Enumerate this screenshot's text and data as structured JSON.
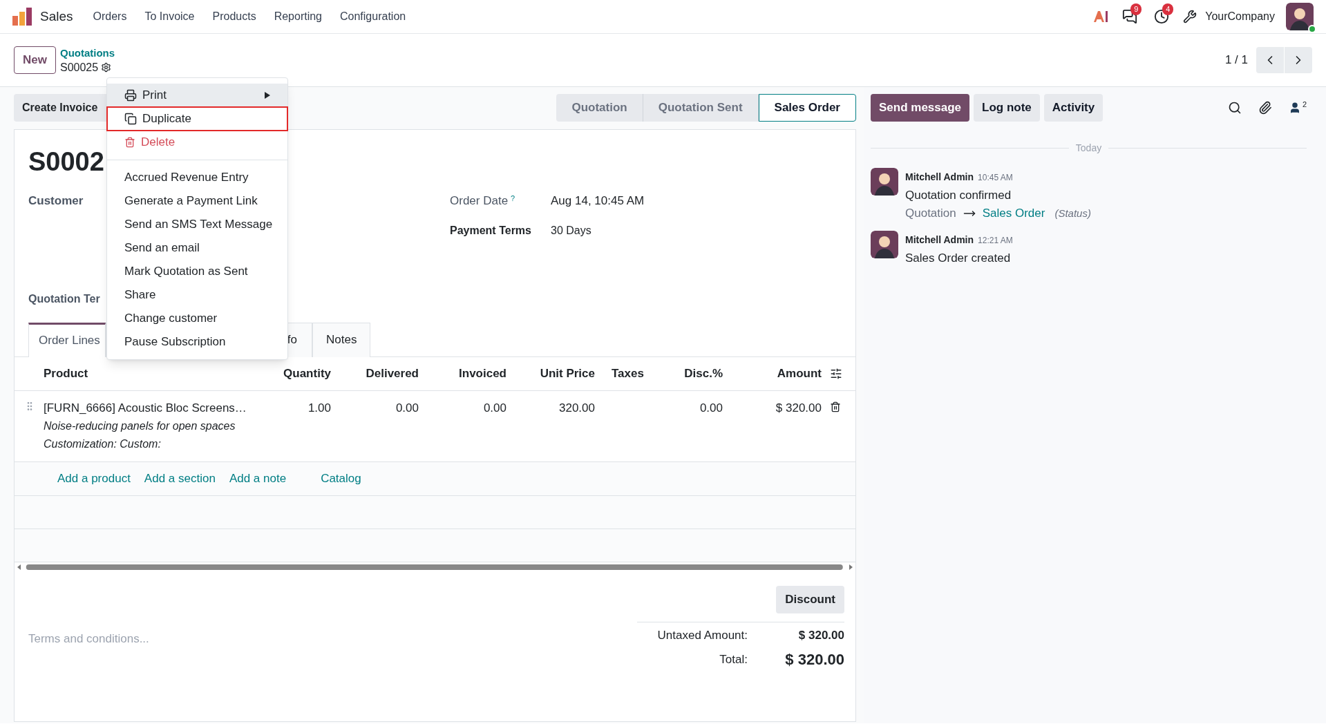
{
  "navbar": {
    "app": "Sales",
    "menus": [
      "Orders",
      "To Invoice",
      "Products",
      "Reporting",
      "Configuration"
    ],
    "badges": [
      {
        "kind": "chat",
        "count": "9"
      },
      {
        "kind": "activity",
        "count": "4"
      }
    ],
    "company": "YourCompany"
  },
  "control_panel": {
    "new_button": "New",
    "breadcrumb": "Quotations",
    "record": "S00025",
    "pager": "1 / 1"
  },
  "create_invoice": "Create Invoice",
  "statusbar": [
    {
      "label": "Quotation",
      "selected": false
    },
    {
      "label": "Quotation Sent",
      "selected": false
    },
    {
      "label": "Sales Order",
      "selected": true
    }
  ],
  "action_menu": {
    "sections": [
      {
        "items": [
          {
            "kind": "submenu",
            "label": "Print",
            "active": true,
            "highlighted": false
          },
          {
            "kind": "duplicate",
            "label": "Duplicate",
            "active": false,
            "highlighted": true
          },
          {
            "kind": "delete",
            "label": "Delete",
            "active": false,
            "highlighted": false
          }
        ]
      },
      {
        "items": [
          {
            "kind": "plain",
            "label": "Accrued Revenue Entry",
            "active": false,
            "highlighted": false
          },
          {
            "kind": "plain",
            "label": "Generate a Payment Link",
            "active": false,
            "highlighted": false
          },
          {
            "kind": "plain",
            "label": "Send an SMS Text Message",
            "active": false,
            "highlighted": false
          },
          {
            "kind": "plain",
            "label": "Send an email",
            "active": false,
            "highlighted": false
          },
          {
            "kind": "plain",
            "label": "Mark Quotation as Sent",
            "active": false,
            "highlighted": false
          },
          {
            "kind": "plain",
            "label": "Share",
            "active": false,
            "highlighted": false
          },
          {
            "kind": "plain",
            "label": "Change customer",
            "active": false,
            "highlighted": false
          },
          {
            "kind": "plain",
            "label": "Pause Subscription",
            "active": false,
            "highlighted": false
          }
        ]
      }
    ]
  },
  "form": {
    "title": "S0002",
    "customer_label": "Customer",
    "order_date_label": "Order Date",
    "order_date_help": "?",
    "order_date": "Aug 14, 10:45 AM",
    "payment_terms_label": "Payment Terms",
    "payment_terms": "30 Days",
    "template_label": "Quotation Ter"
  },
  "tabs": [
    {
      "label": "Order Lines",
      "selected": true
    },
    {
      "label": "fo",
      "selected": false
    },
    {
      "label": "Notes",
      "selected": false
    }
  ],
  "table": {
    "columns": [
      "Product",
      "Quantity",
      "Delivered",
      "Invoiced",
      "Unit Price",
      "Taxes",
      "Disc.%",
      "Amount"
    ],
    "rows": [
      {
        "product": "[FURN_6666] Acoustic Bloc Screens…",
        "description": [
          "Noise-reducing panels for open spaces",
          "Customization: Custom:"
        ],
        "quantity": "1.00",
        "delivered": "0.00",
        "invoiced": "0.00",
        "unit_price": "320.00",
        "discount": "0.00",
        "amount": "$ 320.00"
      }
    ],
    "add_links": [
      "Add a product",
      "Add a section",
      "Add a note",
      "Catalog"
    ]
  },
  "discount_button": "Discount",
  "terms": {
    "placeholder": "Terms and conditions..."
  },
  "totals": [
    {
      "kind": "subtotal",
      "label": "Untaxed Amount:",
      "value": "$ 320.00"
    },
    {
      "kind": "total",
      "label": "Total:",
      "value": "$ 320.00"
    }
  ],
  "chatter": {
    "buttons": [
      {
        "label": "Send message",
        "primary": true
      },
      {
        "label": "Log note",
        "primary": false
      },
      {
        "label": "Activity",
        "primary": false
      }
    ],
    "followers": "2",
    "date_separator": "Today",
    "messages": [
      {
        "author": "Mitchell Admin",
        "time": "10:45 AM",
        "body": "Quotation confirmed",
        "tracking": {
          "old": "Quotation",
          "new": "Sales Order",
          "field": "(Status)"
        }
      },
      {
        "author": "Mitchell Admin",
        "time": "12:21 AM",
        "body": "Sales Order created"
      }
    ]
  }
}
